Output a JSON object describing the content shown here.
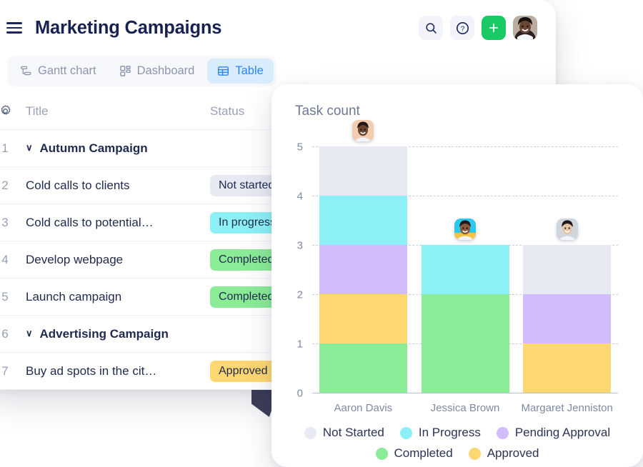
{
  "app": {
    "title": "Marketing Campaigns",
    "menu_icon": "hamburger-icon",
    "actions": [
      {
        "name": "search",
        "icon": "search-icon",
        "label": ""
      },
      {
        "name": "help",
        "icon": "question-circle-icon",
        "label": ""
      },
      {
        "name": "add",
        "icon": "plus-icon",
        "label": ""
      },
      {
        "name": "account",
        "icon": "user-avatar",
        "label": ""
      }
    ],
    "tabs": [
      {
        "label": "Gantt chart",
        "icon": "gantt-icon",
        "active": false
      },
      {
        "label": "Dashboard",
        "icon": "dashboard-grid-icon",
        "active": false
      },
      {
        "label": "Table",
        "icon": "table-icon",
        "active": true
      }
    ]
  },
  "table": {
    "settings_icon": "gear-icon",
    "headers": {
      "title": "Title",
      "status": "Status"
    },
    "rows": [
      {
        "num": "1",
        "title": "Autumn Campaign",
        "group": true,
        "status": "",
        "status_color": ""
      },
      {
        "num": "2",
        "title": "Cold calls to clients",
        "group": false,
        "status": "Not started",
        "status_color": "#e7eaf2"
      },
      {
        "num": "3",
        "title": "Cold calls to potential…",
        "group": false,
        "status": "In progress",
        "status_color": "#8df0f7"
      },
      {
        "num": "4",
        "title": "Develop webpage",
        "group": false,
        "status": "Completed",
        "status_color": "#8aec97"
      },
      {
        "num": "5",
        "title": "Launch campaign",
        "group": false,
        "status": "Completed",
        "status_color": "#8aec97"
      },
      {
        "num": "6",
        "title": "Advertising Campaign",
        "group": true,
        "status": "",
        "status_color": ""
      },
      {
        "num": "7",
        "title": "Buy ad spots in the cit…",
        "group": false,
        "status": "Approved",
        "status_color": "#fcd772"
      }
    ]
  },
  "chart_data": {
    "type": "bar",
    "stacked": true,
    "title": "Task count",
    "xlabel": "",
    "ylabel": "",
    "ylim": [
      0,
      5
    ],
    "yticks": [
      "0",
      "1",
      "2",
      "3",
      "4",
      "5"
    ],
    "grid": true,
    "legend_position": "bottom",
    "categories": [
      "Aaron Davis",
      "Jessica Brown",
      "Margaret Jenniston"
    ],
    "series": [
      {
        "name": "Completed",
        "color": "#8aec97",
        "values": [
          1,
          2,
          0
        ]
      },
      {
        "name": "Approved",
        "color": "#fcd772",
        "values": [
          1,
          0,
          1
        ]
      },
      {
        "name": "Pending Approval",
        "color": "#d2bcfb",
        "values": [
          1,
          0,
          1
        ]
      },
      {
        "name": "In Progress",
        "color": "#8df0f7",
        "values": [
          1,
          1,
          0
        ]
      },
      {
        "name": "Not Started",
        "color": "#e7eaf2",
        "values": [
          1,
          0,
          1
        ]
      }
    ],
    "totals": [
      5,
      3,
      3
    ],
    "legend": [
      {
        "name": "Not Started",
        "color": "#e7eaf2"
      },
      {
        "name": "In Progress",
        "color": "#8df0f7"
      },
      {
        "name": "Pending Approval",
        "color": "#d2bcfb"
      },
      {
        "name": "Completed",
        "color": "#8aec97"
      },
      {
        "name": "Approved",
        "color": "#fcd772"
      }
    ],
    "avatars": [
      {
        "name": "Aaron Davis",
        "skin": "#6e4630",
        "bg": "#f2cdb0",
        "ring": ""
      },
      {
        "name": "Jessica Brown",
        "skin": "#8a5b3c",
        "bg": "#2fc8ec",
        "ring": "#f6c344"
      },
      {
        "name": "Margaret Jenniston",
        "skin": "#e7c3a5",
        "bg": "#cfd6dd",
        "ring": ""
      }
    ]
  },
  "colors": {
    "accent_green": "#18c964",
    "tab_active_bg": "#d9ecfe",
    "tab_active_text": "#2a86f2",
    "text_dark": "#182252",
    "text_muted": "#98a1b6"
  }
}
